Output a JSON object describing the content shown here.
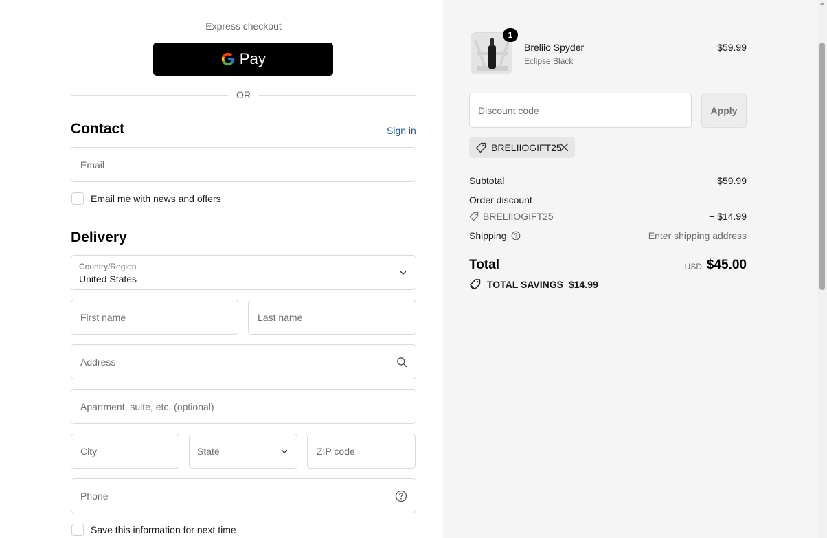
{
  "express": {
    "heading": "Express checkout",
    "gpay_label": "Pay",
    "or_text": "OR"
  },
  "contact": {
    "title": "Contact",
    "sign_in": "Sign in",
    "email_placeholder": "Email",
    "news_label": "Email me with news and offers"
  },
  "delivery": {
    "title": "Delivery",
    "country_label": "Country/Region",
    "country_value": "United States",
    "first_name_placeholder": "First name",
    "last_name_placeholder": "Last name",
    "address_placeholder": "Address",
    "apartment_placeholder": "Apartment, suite, etc. (optional)",
    "city_placeholder": "City",
    "state_placeholder": "State",
    "zip_placeholder": "ZIP code",
    "phone_placeholder": "Phone",
    "save_label": "Save this information for next time"
  },
  "order": {
    "item": {
      "quantity": "1",
      "name": "Breliio Spyder",
      "variant": "Eclipse Black",
      "price": "$59.99"
    },
    "discount_placeholder": "Discount code",
    "apply_label": "Apply",
    "applied_code": "BRELIIOGIFT25",
    "subtotal_label": "Subtotal",
    "subtotal_value": "$59.99",
    "order_discount_label": "Order discount",
    "discount_code": "BRELIIOGIFT25",
    "discount_value": "− $14.99",
    "shipping_label": "Shipping",
    "shipping_value": "Enter shipping address",
    "total_label": "Total",
    "currency": "USD",
    "total_value": "$45.00",
    "savings_label": "TOTAL SAVINGS",
    "savings_value": "$14.99"
  },
  "colors": {
    "link": "#1a5aa8",
    "sidebar_bg": "#f5f5f5"
  }
}
